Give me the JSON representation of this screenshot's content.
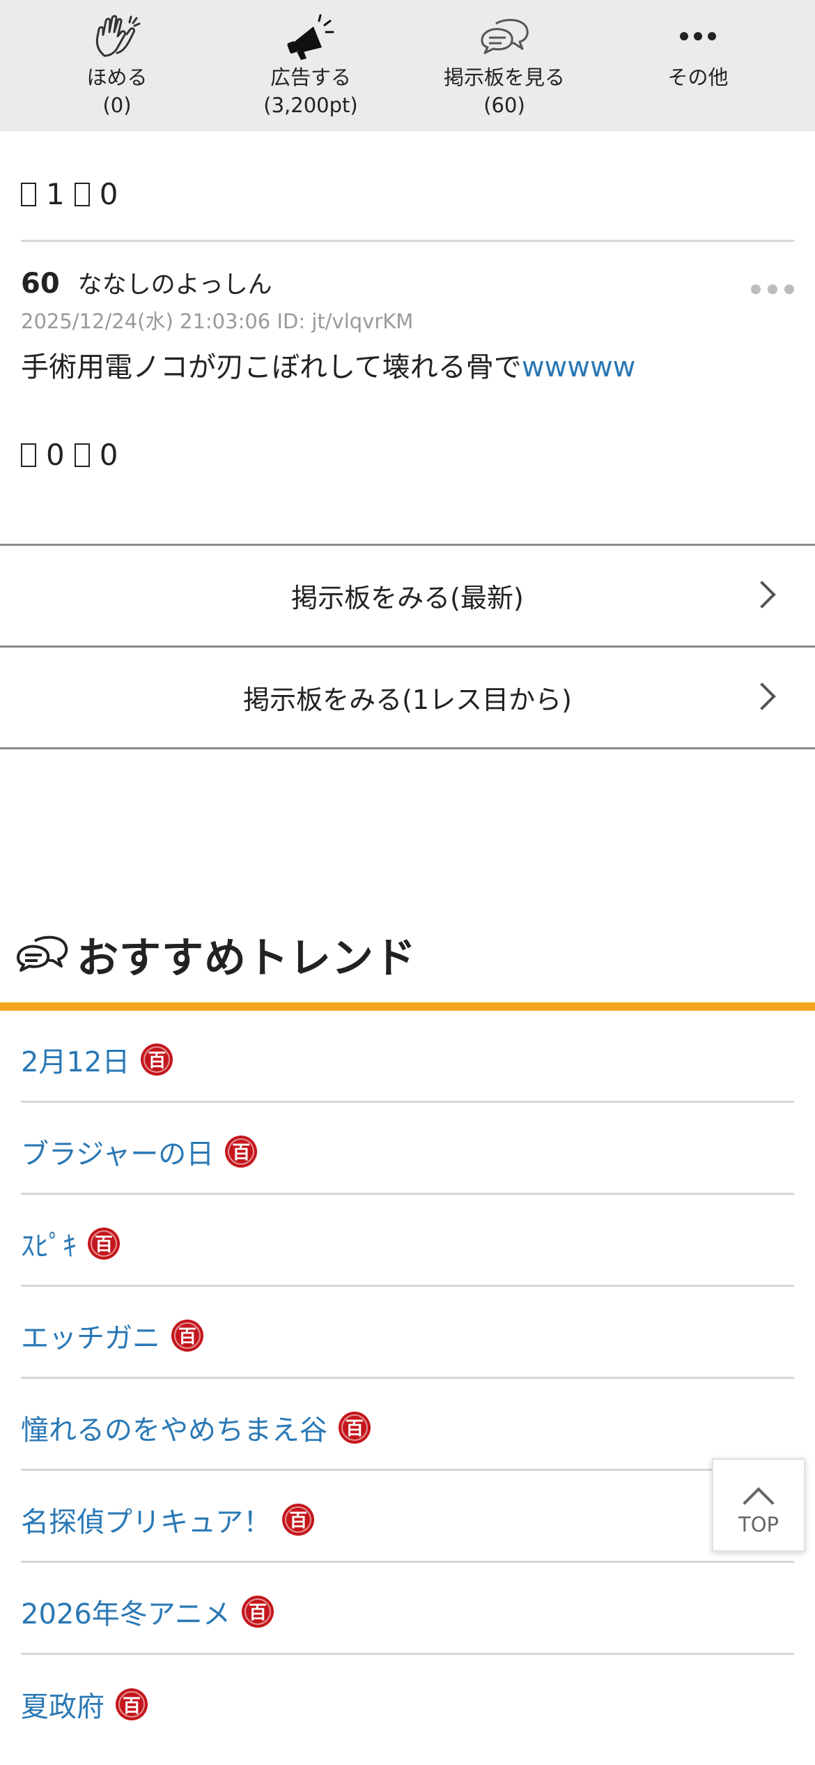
{
  "action_bar": {
    "praise": {
      "label": "ほめる",
      "count": "(0)"
    },
    "advertise": {
      "label": "広告する",
      "count": "(3,200pt)"
    },
    "view_board": {
      "label": "掲示板を見る",
      "count": "(60)"
    },
    "other": {
      "label": "その他"
    }
  },
  "previous_post": {
    "good": "1",
    "bad": "0"
  },
  "post": {
    "number": "60",
    "name": "ななしのよっしん",
    "meta": "2025/12/24(水) 21:03:06 ID: jt/vlqvrKM",
    "body_text": "手術用電ノコが刃こぼれして壊れる骨で",
    "body_link": "wwwww",
    "good": "0",
    "bad": "0"
  },
  "board_buttons": {
    "latest": "掲示板をみる(最新)",
    "from_first": "掲示板をみる(1レス目から)"
  },
  "trends": {
    "title": "おすすめトレンド",
    "badge": "百",
    "items": [
      "2月12日",
      "ブラジャーの日",
      "ｽﾋﾟｷ",
      "エッチガニ",
      "憧れるのをやめちまえ谷",
      "名探偵プリキュア！",
      "2026年冬アニメ",
      "夏政府"
    ]
  },
  "top_button": {
    "label": "TOP"
  },
  "colors": {
    "link": "#2a78b5",
    "accent": "#f5a61f",
    "badge": "#c4161c",
    "action_bar_bg": "#ebebeb"
  }
}
